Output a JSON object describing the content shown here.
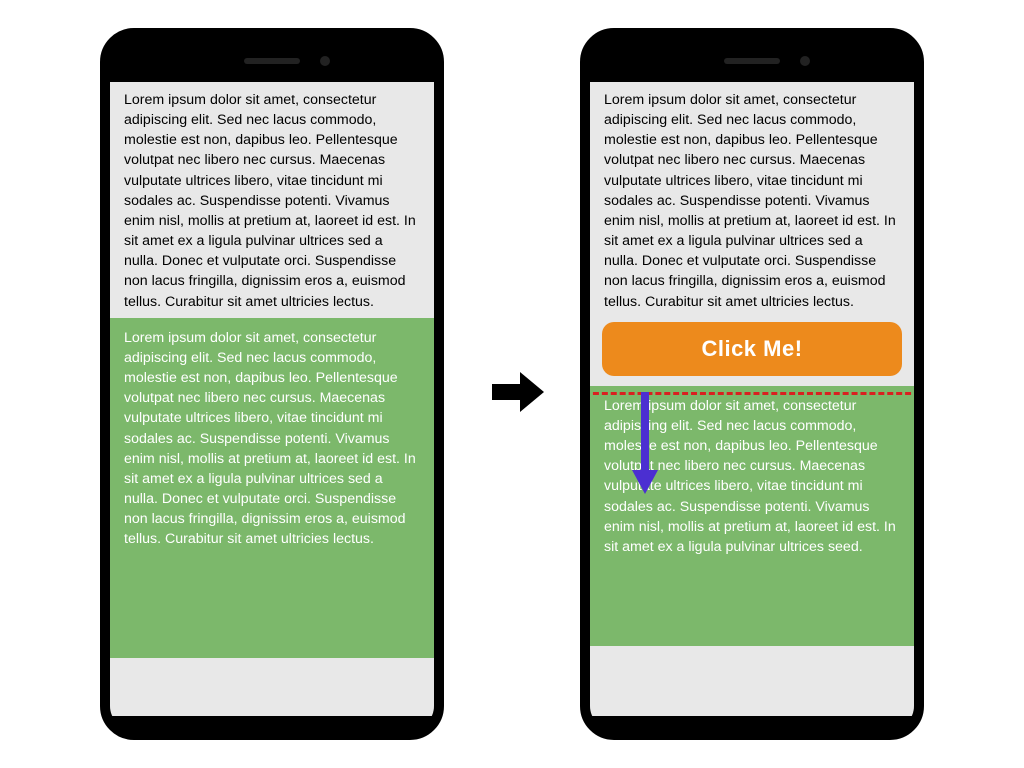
{
  "lorem_full": "Lorem ipsum dolor sit amet, consectetur adipiscing elit. Sed nec lacus commodo, molestie est non, dapibus leo. Pellentesque volutpat nec libero nec cursus. Maecenas vulputate ultrices libero, vitae tincidunt mi sodales ac. Suspendisse potenti. Vivamus enim nisl, mollis at pretium at, laoreet id est. In sit amet ex a ligula pulvinar ultrices sed a nulla. Donec et vulputate orci. Suspendisse non lacus fringilla, dignissim eros a, euismod tellus. Curabitur sit amet ultricies lectus.",
  "lorem_shifted": "Lorem ipsum dolor sit amet, consectetur adipiscing elit. Sed nec lacus commodo, molestie est non, dapibus leo. Pellentesque volutpat nec libero nec cursus. Maecenas vulputate ultrices libero, vitae tincidunt mi sodales ac. Suspendisse potenti. Vivamus enim nisl, mollis at pretium at, laoreet id est. In sit amet ex a ligula pulvinar ultrices seed.",
  "button_label": "Click Me!",
  "colors": {
    "button_bg": "#ed8a1c",
    "green_bg": "#7cb86b",
    "highlight": "#d92020",
    "shift_arrow": "#4b2fd1"
  }
}
